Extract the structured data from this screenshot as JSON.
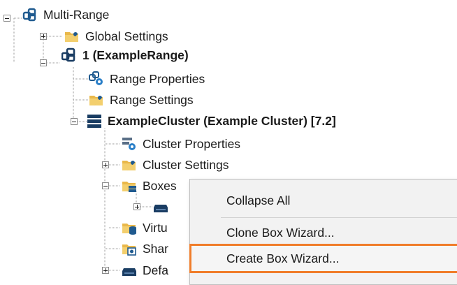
{
  "tree": {
    "root": {
      "label": "Multi-Range",
      "icon": "multi-range-icon"
    },
    "global_settings": {
      "label": "Global Settings",
      "icon": "folder-wrench-icon"
    },
    "range": {
      "label": "1 (ExampleRange)",
      "icon": "range-icon"
    },
    "range_properties": {
      "label": "Range Properties",
      "icon": "range-properties-icon"
    },
    "range_settings": {
      "label": "Range Settings",
      "icon": "folder-wrench-icon"
    },
    "cluster": {
      "label": "ExampleCluster (Example Cluster) [7.2]",
      "icon": "server-stack-icon"
    },
    "cluster_properties": {
      "label": "Cluster Properties",
      "icon": "cluster-properties-icon"
    },
    "cluster_settings": {
      "label": "Cluster Settings",
      "icon": "folder-wrench-icon"
    },
    "boxes": {
      "label": "Boxes",
      "icon": "folder-server-icon"
    },
    "box_child": {
      "label": "",
      "icon": "box-server-icon"
    },
    "virtual": {
      "label": "Virtu",
      "icon": "folder-database-icon"
    },
    "shared": {
      "label": "Shar",
      "icon": "folder-settings-icon"
    },
    "default": {
      "label": "Defa",
      "icon": "box-server-icon"
    }
  },
  "context_menu": {
    "items": [
      {
        "label": "Collapse All"
      },
      {
        "label": "Clone Box Wizard..."
      },
      {
        "label": "Create Box Wizard...",
        "selected": true
      }
    ]
  },
  "colors": {
    "highlight_border": "#f07d2a",
    "folder_yellow": "#e9b84a",
    "icon_blue": "#1f5a8f"
  }
}
